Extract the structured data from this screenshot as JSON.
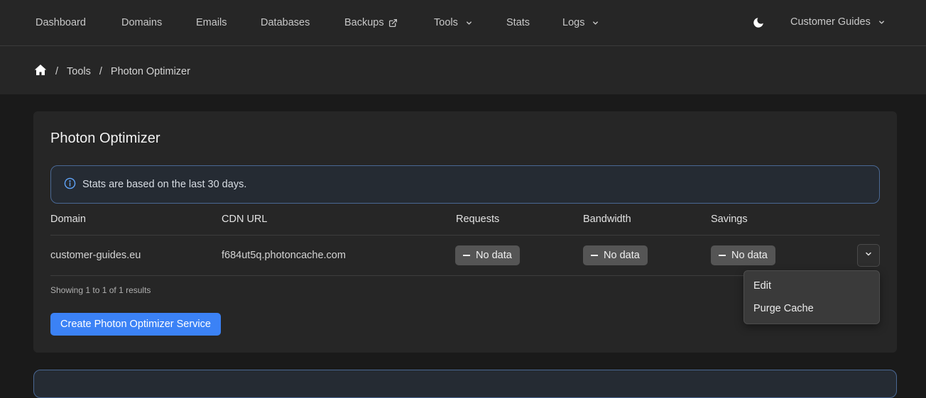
{
  "nav": {
    "items": [
      {
        "label": "Dashboard"
      },
      {
        "label": "Domains"
      },
      {
        "label": "Emails"
      },
      {
        "label": "Databases"
      },
      {
        "label": "Backups",
        "icon": "external-link-icon"
      },
      {
        "label": "Tools",
        "icon": "chevron-down-icon"
      },
      {
        "label": "Stats"
      },
      {
        "label": "Logs",
        "icon": "chevron-down-icon"
      }
    ],
    "theme_icon": "moon-icon",
    "account": {
      "label": "Customer Guides",
      "icon": "chevron-down-icon"
    }
  },
  "breadcrumb": {
    "home_icon": "home-icon",
    "separator": "/",
    "items": [
      "Tools",
      "Photon Optimizer"
    ]
  },
  "card": {
    "title": "Photon Optimizer",
    "alert": {
      "icon": "info-icon",
      "text": "Stats are based on the last 30 days."
    },
    "table": {
      "headers": [
        "Domain",
        "CDN URL",
        "Requests",
        "Bandwidth",
        "Savings"
      ],
      "rows": [
        {
          "domain": "customer-guides.eu",
          "cdn_url": "f684ut5q.photoncache.com",
          "requests": "No data",
          "bandwidth": "No data",
          "savings": "No data"
        }
      ]
    },
    "results_text": "Showing 1 to 1 of 1 results",
    "create_button": "Create Photon Optimizer Service"
  },
  "row_menu": {
    "items": [
      "Edit",
      "Purge Cache"
    ]
  },
  "colors": {
    "accent": "#3b82f6",
    "alert_border": "#4a6894",
    "background": "#1a1a1a",
    "surface": "#262626"
  }
}
